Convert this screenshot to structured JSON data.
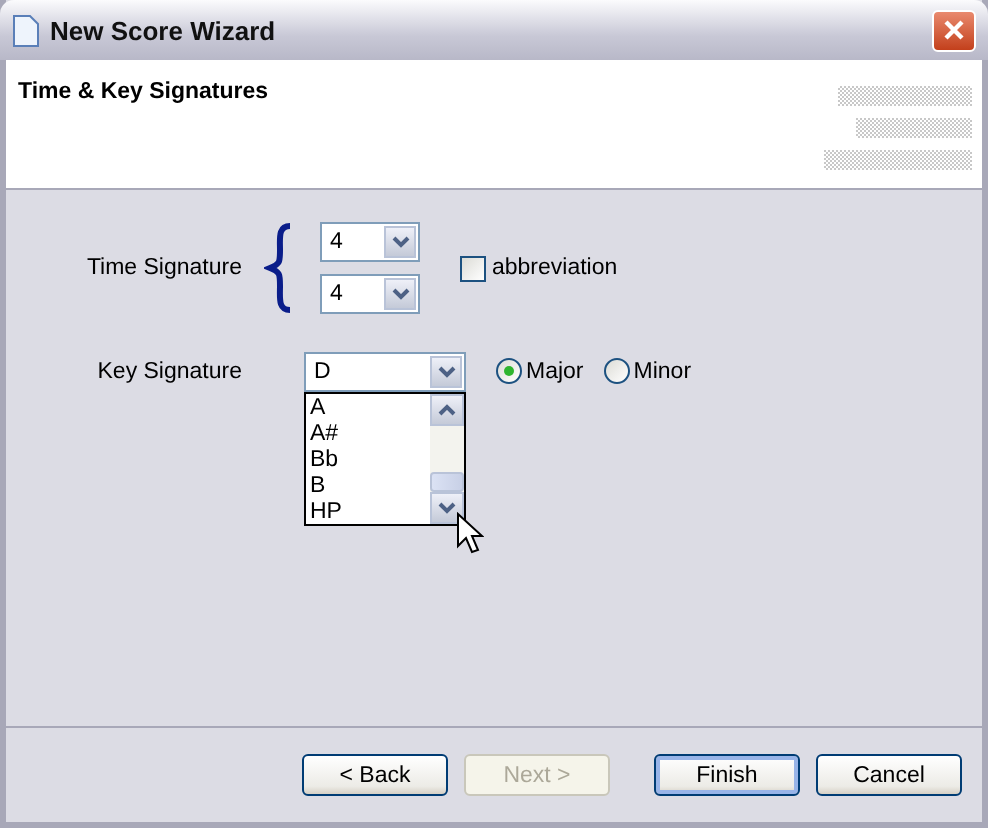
{
  "window": {
    "title": "New Score Wizard"
  },
  "header": {
    "title": "Time & Key Signatures"
  },
  "time_signature": {
    "label": "Time Signature",
    "numerator": "4",
    "denominator": "4",
    "abbreviation": {
      "label": "abbreviation",
      "checked": false
    }
  },
  "key_signature": {
    "label": "Key Signature",
    "value": "D",
    "dropdown": {
      "expanded": true,
      "options": [
        "A",
        "A#",
        "Bb",
        "B",
        "HP"
      ]
    },
    "modes": [
      {
        "label": "Major",
        "selected": true
      },
      {
        "label": "Minor",
        "selected": false
      }
    ]
  },
  "buttons": [
    {
      "label": "< Back",
      "disabled": false,
      "default": false
    },
    {
      "label": "Next >",
      "disabled": true,
      "default": false
    },
    {
      "label": "Finish",
      "disabled": false,
      "default": true
    },
    {
      "label": "Cancel",
      "disabled": false,
      "default": false
    }
  ]
}
